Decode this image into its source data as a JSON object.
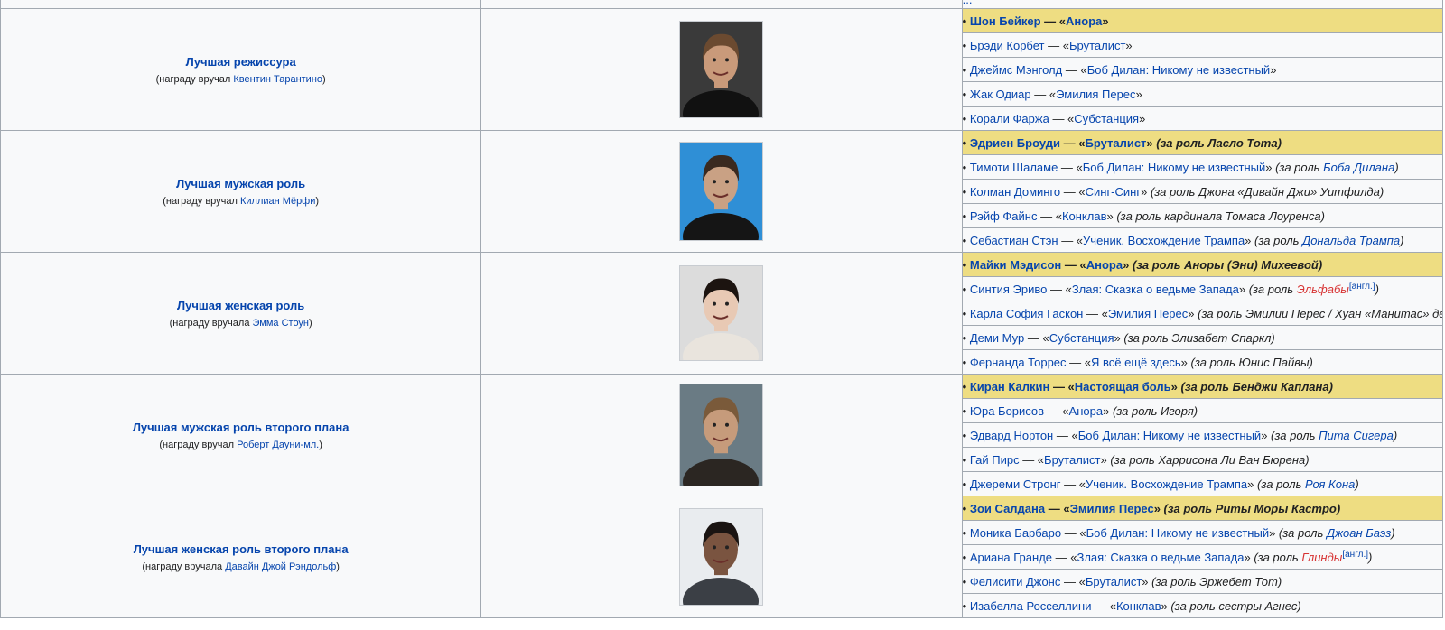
{
  "top_strip_text": "...",
  "categories": [
    {
      "title": "Лучшая режиссура",
      "presenter_prefix": "(награду вручал ",
      "presenter_name": "Квентин Тарантино",
      "presenter_suffix": ")",
      "photo_icon": "portrait-photo",
      "nominees": [
        {
          "name": "Шон Бейкер",
          "sep": " — «",
          "film": "Анора",
          "close": "»"
        },
        {
          "name": "Брэди Корбет",
          "sep": " — «",
          "film": "Бруталист",
          "close": "»"
        },
        {
          "name": "Джеймс Мэнголд",
          "sep": " — «",
          "film": "Боб Дилан: Никому не известный",
          "close": "»"
        },
        {
          "name": "Жак Одиар",
          "sep": " — «",
          "film": "Эмилия Перес",
          "close": "»"
        },
        {
          "name": "Корали Фаржа",
          "sep": " — «",
          "film": "Субстанция",
          "close": "»"
        }
      ]
    },
    {
      "title": "Лучшая мужская роль",
      "presenter_prefix": "(награду вручал ",
      "presenter_name": "Киллиан Мёрфи",
      "presenter_suffix": ")",
      "photo_icon": "portrait-photo",
      "nominees": [
        {
          "name": "Эдриен Броуди",
          "sep": " — «",
          "film": "Бруталист",
          "close": "» ",
          "role_pre": "(за роль Ласло Тота)"
        },
        {
          "name": "Тимоти Шаламе",
          "sep": " — «",
          "film": "Боб Дилан: Никому не известный",
          "close": "» ",
          "role_pre": "(за роль ",
          "role_link": "Боба Дилана",
          "role_post": ")"
        },
        {
          "name": "Колман Доминго",
          "sep": " — «",
          "film": "Синг-Синг",
          "close": "» ",
          "role_pre": "(за роль Джона «Дивайн Джи» Уитфилда)"
        },
        {
          "name": "Рэйф Файнс",
          "sep": " — «",
          "film": "Конклав",
          "close": "» ",
          "role_pre": "(за роль кардинала Томаса Лоуренса)"
        },
        {
          "name": "Себастиан Стэн",
          "sep": " — «",
          "film": "Ученик. Восхождение Трампа",
          "close": "» ",
          "role_pre": "(за роль ",
          "role_link": "Дональда Трампа",
          "role_post": ")"
        }
      ]
    },
    {
      "title": "Лучшая женская роль",
      "presenter_prefix": "(награду вручала ",
      "presenter_name": "Эмма Стоун",
      "presenter_suffix": ")",
      "photo_icon": "portrait-photo",
      "nominees": [
        {
          "name": "Майки Мэдисон",
          "sep": " — «",
          "film": "Анора",
          "close": "» ",
          "role_pre": "(за роль Аноры (Эни) Михеевой)"
        },
        {
          "name": "Синтия Эриво",
          "sep": " — «",
          "film": "Злая: Сказка о ведьме Запада",
          "close": "» ",
          "role_pre": "(за роль ",
          "role_red": "Эльфабы",
          "role_sup": "[англ.]",
          "role_post": ")"
        },
        {
          "name": "Карла София Гаскон",
          "sep": " — «",
          "film": "Эмилия Перес",
          "close": "» ",
          "role_pre": "(за роль Эмилии Перес / Хуан «Манитас» дель Монте)"
        },
        {
          "name": "Деми Мур",
          "sep": " — «",
          "film": "Субстанция",
          "close": "» ",
          "role_pre": "(за роль Элизабет Спаркл)"
        },
        {
          "name": "Фернанда Торрес",
          "sep": " — «",
          "film": "Я всё ещё здесь",
          "close": "» ",
          "role_pre": "(за роль Юнис Пайвы)"
        }
      ]
    },
    {
      "title": "Лучшая мужская роль второго плана",
      "presenter_prefix": "(награду вручал ",
      "presenter_name": "Роберт Дауни-мл.",
      "presenter_suffix": ")",
      "photo_icon": "portrait-photo",
      "nominees": [
        {
          "name": "Киран Калкин",
          "sep": " — «",
          "film": "Настоящая боль",
          "close": "» ",
          "role_pre": "(за роль Бенджи Каплана)"
        },
        {
          "name": "Юра Борисов",
          "sep": " — «",
          "film": "Анора",
          "close": "» ",
          "role_pre": "(за роль Игоря)"
        },
        {
          "name": "Эдвард Нортон",
          "sep": " — «",
          "film": "Боб Дилан: Никому не известный",
          "close": "» ",
          "role_pre": "(за роль ",
          "role_link": "Пита Сигера",
          "role_post": ")"
        },
        {
          "name": "Гай Пирс",
          "sep": " — «",
          "film": "Бруталист",
          "close": "» ",
          "role_pre": "(за роль Харрисона Ли Ван Бюрена)"
        },
        {
          "name": "Джереми Стронг",
          "sep": " — «",
          "film": "Ученик. Восхождение Трампа",
          "close": "» ",
          "role_pre": "(за роль ",
          "role_link": "Роя Кона",
          "role_post": ")"
        }
      ]
    },
    {
      "title": "Лучшая женская роль второго плана",
      "presenter_prefix": "(награду вручала ",
      "presenter_name": "Давайн Джой Рэндольф",
      "presenter_suffix": ")",
      "photo_icon": "portrait-photo",
      "nominees": [
        {
          "name": "Зои Салдана",
          "sep": " — «",
          "film": "Эмилия Перес",
          "close": "» ",
          "role_pre": "(за роль Риты Моры Кастро)"
        },
        {
          "name": "Моника Барбаро",
          "sep": " — «",
          "film": "Боб Дилан: Никому не известный",
          "close": "» ",
          "role_pre": "(за роль ",
          "role_link": "Джоан Баэз",
          "role_post": ")"
        },
        {
          "name": "Ариана Гранде",
          "sep": " — «",
          "film": "Злая: Сказка о ведьме Запада",
          "close": "» ",
          "role_pre": "(за роль ",
          "role_red": "Глинды",
          "role_sup": "[англ.]",
          "role_post": ")"
        },
        {
          "name": "Фелисити Джонс",
          "sep": " — «",
          "film": "Бруталист",
          "close": "» ",
          "role_pre": "(за роль Эржебет Тот)"
        },
        {
          "name": "Изабелла Росселлини",
          "sep": " — «",
          "film": "Конклав",
          "close": "» ",
          "role_pre": "(за роль сестры Агнес)"
        }
      ]
    }
  ],
  "colors": {
    "winner_bg": "#eedd82",
    "cell_bg": "#f8f9fa",
    "link": "#0645ad",
    "redlink": "#d73333",
    "border": "#a2a9b1"
  }
}
